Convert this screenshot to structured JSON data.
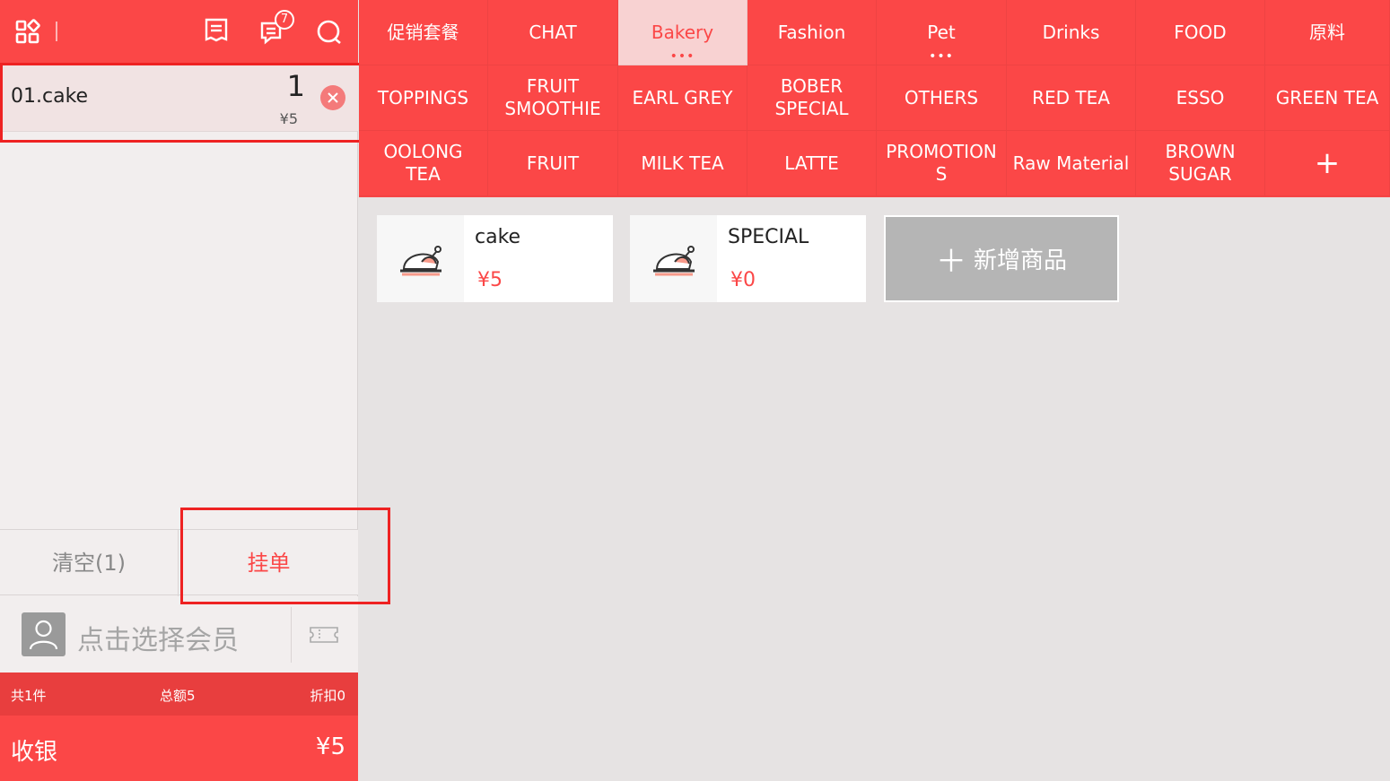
{
  "topbar": {
    "notification_count": "7"
  },
  "cart": {
    "items": [
      {
        "name": "01.cake",
        "qty": "1",
        "price": "¥5"
      }
    ],
    "clear_label": "清空(1)",
    "hang_label": "挂单"
  },
  "member": {
    "placeholder": "点击选择会员"
  },
  "summary": {
    "count": "共1件",
    "total": "总额5",
    "discount": "折扣0"
  },
  "checkout": {
    "label": "收银",
    "amount": "¥5"
  },
  "categories": {
    "row1": [
      "促销套餐",
      "CHAT",
      "Bakery",
      "Fashion",
      "Pet",
      "Drinks",
      "FOOD",
      "原料"
    ],
    "row2": [
      "TOPPINGS",
      "FRUIT SMOOTHIE",
      "EARL GREY",
      "BOBER SPECIAL",
      "OTHERS",
      "RED TEA",
      "ESSO",
      "GREEN TEA"
    ],
    "row3": [
      "OOLONG TEA",
      "FRUIT",
      "MILK TEA",
      "LATTE",
      "PROMOTION S",
      "Raw Material",
      "BROWN SUGAR",
      "+"
    ],
    "active": "Bakery"
  },
  "products": [
    {
      "name": "cake",
      "price": "¥5"
    },
    {
      "name": "SPECIAL",
      "price": "¥0"
    }
  ],
  "add_product_label": "新增商品",
  "colors": {
    "primary": "#fb4747",
    "active_tab_bg": "#f8d2d2",
    "panel_bg": "#f2eeee",
    "content_bg": "#e6e3e3",
    "add_product_bg": "#b5b5b5"
  }
}
